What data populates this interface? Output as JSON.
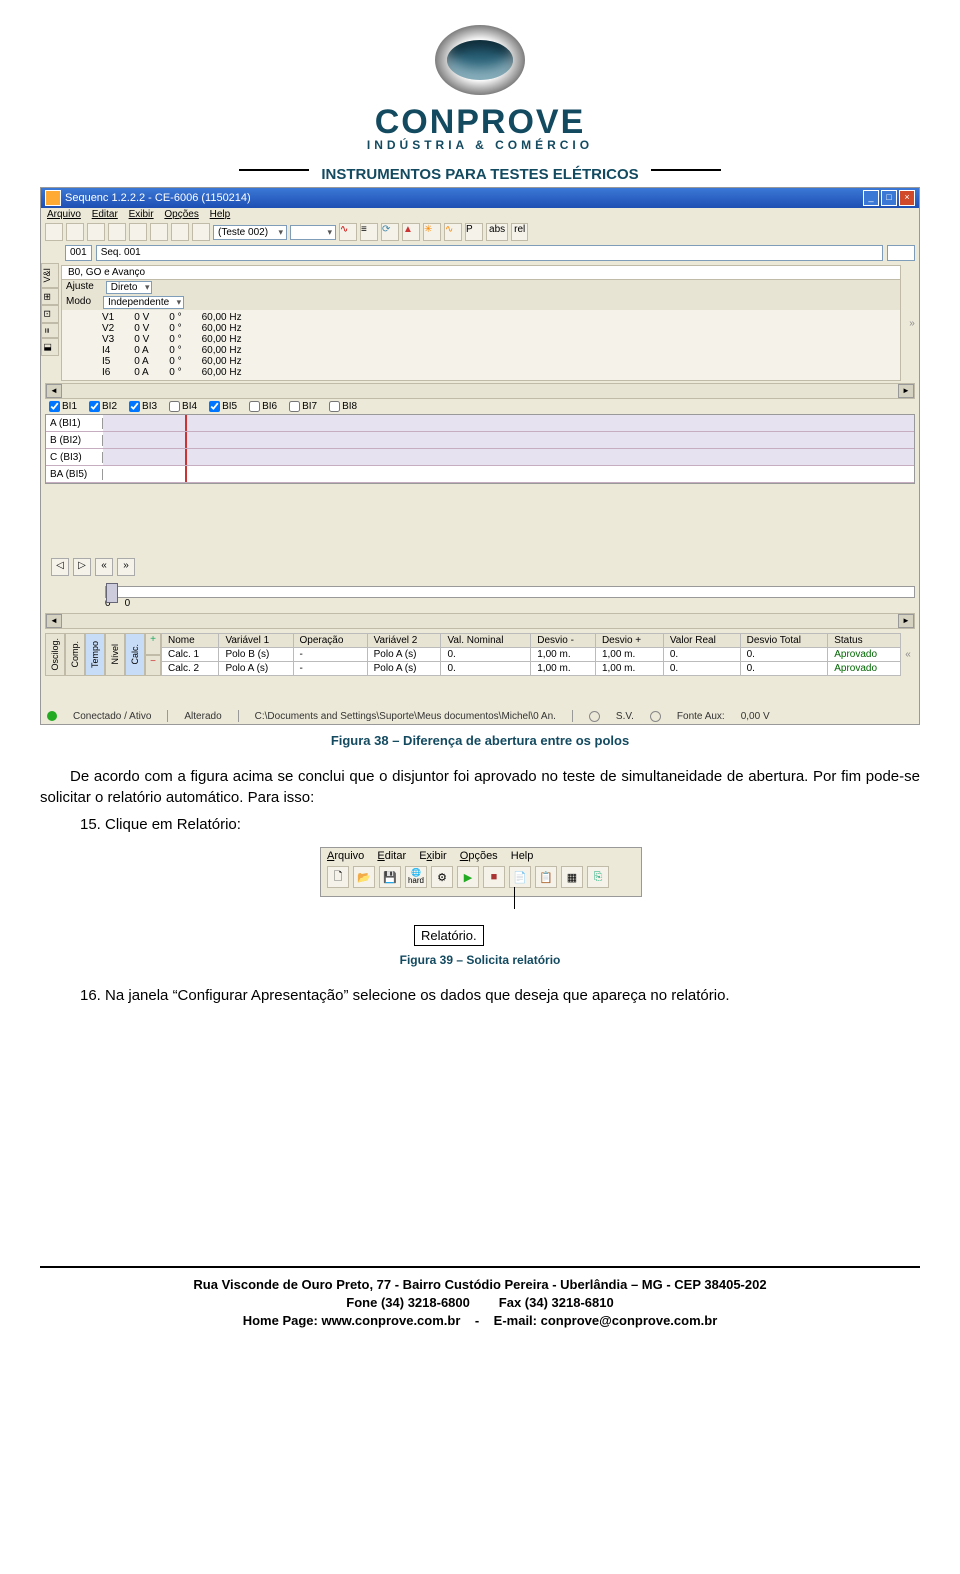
{
  "logo": {
    "name": "CONPROVE",
    "sub": "INDÚSTRIA & COMÉRCIO"
  },
  "banner_title": "INSTRUMENTOS PARA TESTES ELÉTRICOS",
  "screenshot1": {
    "title": "Sequenc 1.2.2.2 - CE-6006 (1150214)",
    "menu": [
      "Arquivo",
      "Editar",
      "Exibir",
      "Opções",
      "Help"
    ],
    "testname": "(Teste 002)",
    "seq": {
      "num": "001",
      "label": "Seq. 001"
    },
    "tab_header": "B0, GO e Avanço",
    "config_row1": {
      "k1": "Ajuste",
      "k2": "Direto"
    },
    "config_row2": {
      "k1": "Modo",
      "k2": "Independente"
    },
    "table": [
      {
        "ch": "V1",
        "v": "0 V",
        "a": "0 °",
        "f": "60,00 Hz"
      },
      {
        "ch": "V2",
        "v": "0 V",
        "a": "0 °",
        "f": "60,00 Hz"
      },
      {
        "ch": "V3",
        "v": "0 V",
        "a": "0 °",
        "f": "60,00 Hz"
      },
      {
        "ch": "I4",
        "v": "0 A",
        "a": "0 °",
        "f": "60,00 Hz"
      },
      {
        "ch": "I5",
        "v": "0 A",
        "a": "0 °",
        "f": "60,00 Hz"
      },
      {
        "ch": "I6",
        "v": "0 A",
        "a": "0 °",
        "f": "60,00 Hz"
      }
    ],
    "bis": [
      {
        "l": "BI1",
        "c": true
      },
      {
        "l": "BI2",
        "c": true
      },
      {
        "l": "BI3",
        "c": true
      },
      {
        "l": "BI4",
        "c": false
      },
      {
        "l": "BI5",
        "c": true
      },
      {
        "l": "BI6",
        "c": false
      },
      {
        "l": "BI7",
        "c": false
      },
      {
        "l": "BI8",
        "c": false
      }
    ],
    "signals": [
      "A (BI1)",
      "B (BI2)",
      "C (BI3)",
      "BA (BI5)"
    ],
    "slider": {
      "left": "0",
      "right": "0"
    },
    "results": {
      "headers": [
        "Nome",
        "Variável 1",
        "Operação",
        "Variável 2",
        "Val. Nominal",
        "Desvio -",
        "Desvio +",
        "Valor Real",
        "Desvio Total",
        "Status"
      ],
      "rows": [
        [
          "Calc. 1",
          "Polo B (s)",
          "-",
          "Polo A (s)",
          "0.",
          "1,00 m.",
          "1,00 m.",
          "0.",
          "0.",
          "Aprovado"
        ],
        [
          "Calc. 2",
          "Polo A (s)",
          "-",
          "Polo A (s)",
          "0.",
          "1,00 m.",
          "1,00 m.",
          "0.",
          "0.",
          "Aprovado"
        ]
      ],
      "vtabs": [
        "Oscilog.",
        "Comp.",
        "Tempo",
        "Nível",
        "Calc."
      ]
    },
    "status": {
      "conn": "Conectado / Ativo",
      "alt": "Alterado",
      "path": "C:\\Documents and Settings\\Suporte\\Meus documentos\\Michel\\0 An.",
      "sv": "S.V.",
      "fonte": "Fonte Aux:",
      "fv": "0,00 V"
    }
  },
  "caption1": "Figura 38 – Diferença de abertura entre os polos",
  "para1": "De acordo com a figura acima se conclui que o disjuntor foi aprovado no teste de simultaneidade de abertura. Por fim pode-se solicitar o relatório automático. Para isso:",
  "step15": "15. Clique em Relatório:",
  "screenshot2": {
    "menu": [
      "Arquivo",
      "Editar",
      "Exibir",
      "Opções",
      "Help"
    ],
    "callout": "Relatório.",
    "hard_label": "hard"
  },
  "caption2": "Figura 39 – Solicita relatório",
  "step16": "16. Na janela “Configurar Apresentação” selecione os dados que deseja que apareça no relatório.",
  "footer": {
    "l1": "Rua Visconde de Ouro Preto, 77 - Bairro Custódio Pereira - Uberlândia – MG - CEP 38405-202",
    "l2a": "Fone (34) 3218-6800",
    "l2b": "Fax (34) 3218-6810",
    "l3a": "Home Page: www.conprove.com.br",
    "l3sep": "-",
    "l3b": "E-mail: conprove@conprove.com.br"
  }
}
